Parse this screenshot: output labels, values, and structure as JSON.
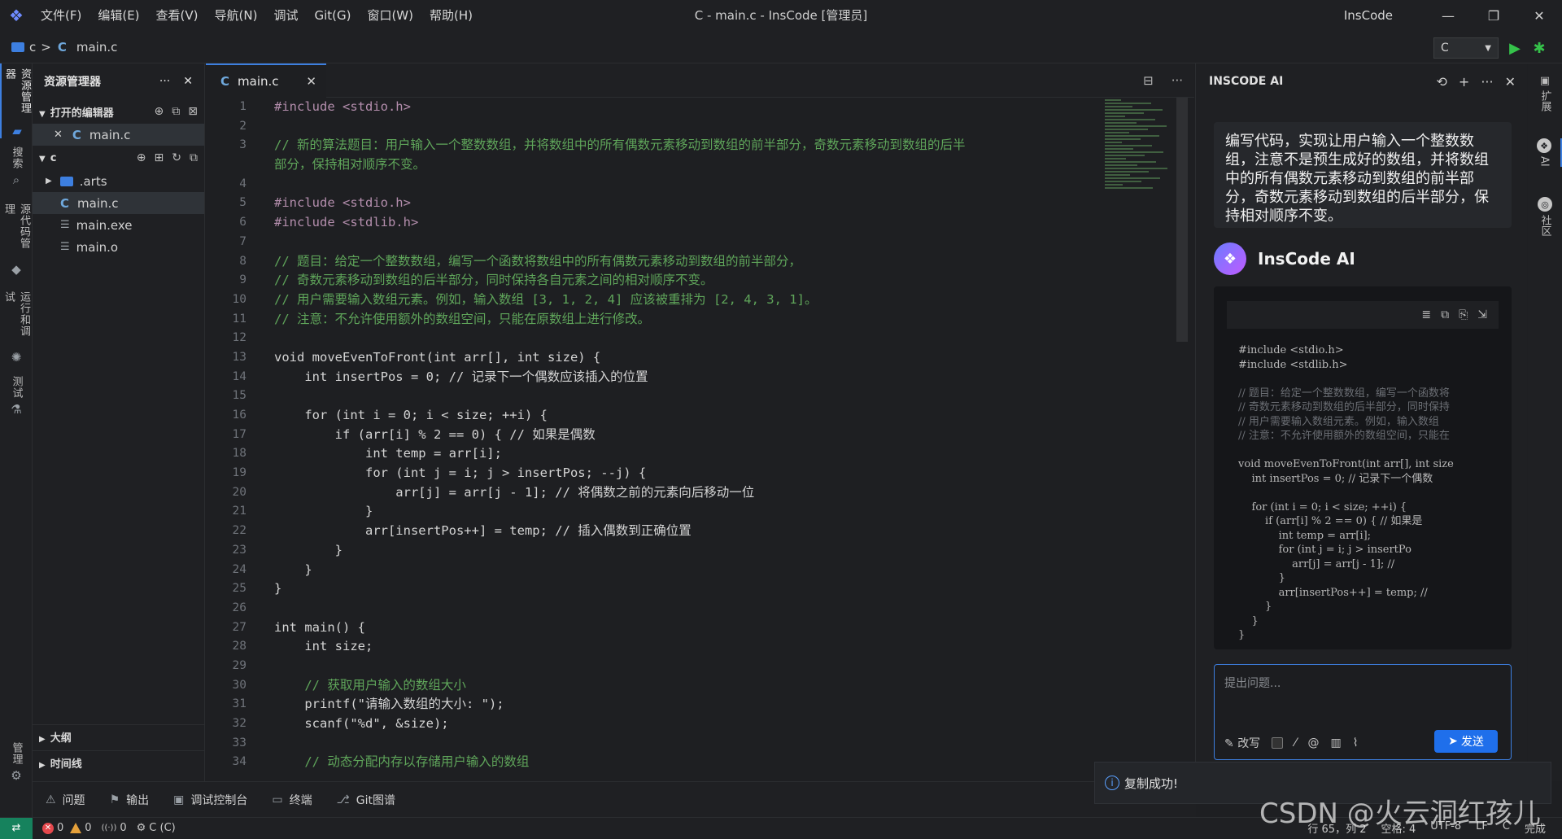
{
  "titlebar": {
    "menus": [
      "文件(F)",
      "编辑(E)",
      "查看(V)",
      "导航(N)",
      "调试",
      "Git(G)",
      "窗口(W)",
      "帮助(H)"
    ],
    "title": "C - main.c - InsCode [管理员]",
    "app_name": "InsCode",
    "minimize": "—",
    "maximize": "❐",
    "close": "✕"
  },
  "breadcrumb": {
    "folder": "c",
    "sep": ">",
    "file": "main.c",
    "file_icon": "C"
  },
  "run_config": {
    "language": "C",
    "caret": "▼",
    "run_glyph": "▶",
    "debug_glyph": "✱"
  },
  "activity_left": {
    "tabs": [
      {
        "label": "资源管理器",
        "icon": "folder-icon"
      },
      {
        "label": "搜索",
        "icon": "search-icon"
      },
      {
        "label": "源代码管理",
        "icon": "source-control-icon"
      },
      {
        "label": "运行和调试",
        "icon": "debug-icon"
      },
      {
        "label": "测试",
        "icon": "flask-icon"
      },
      {
        "label": "管理",
        "icon": "gear-icon"
      }
    ]
  },
  "sidebar": {
    "title": "资源管理器",
    "more": "···",
    "close": "✕",
    "open_editors_label": "打开的编辑器",
    "open_editors": [
      {
        "close": "✕",
        "icon": "C",
        "name": "main.c"
      }
    ],
    "root_label": "c",
    "tree": [
      {
        "name": ".arts",
        "type": "folder"
      },
      {
        "name": "main.c",
        "type": "c"
      },
      {
        "name": "main.exe",
        "type": "file"
      },
      {
        "name": "main.o",
        "type": "file"
      }
    ],
    "outline_label": "大纲",
    "timeline_label": "时间线"
  },
  "editor": {
    "tab_label": "main.c",
    "tab_icon": "C",
    "tab_close": "✕",
    "actions": [
      "⊟",
      "···"
    ],
    "line_numbers": [
      "1",
      "2",
      "3",
      "",
      "4",
      "5",
      "6",
      "7",
      "8",
      "9",
      "10",
      "11",
      "12",
      "13",
      "14",
      "15",
      "16",
      "17",
      "18",
      "19",
      "20",
      "21",
      "22",
      "23",
      "24",
      "25",
      "26",
      "27",
      "28",
      "29",
      "30",
      "31",
      "32",
      "33",
      "34"
    ],
    "lines": [
      "#include <stdio.h>",
      "",
      "// 新的算法题目：用户输入一个整数数组，并将数组中的所有偶数元素移动到数组的前半部分，奇数元素移动到数组的后半",
      "部分，保持相对顺序不变。",
      "",
      "#include <stdio.h>",
      "#include <stdlib.h>",
      "",
      "// 题目：给定一个整数数组，编写一个函数将数组中的所有偶数元素移动到数组的前半部分，",
      "// 奇数元素移动到数组的后半部分，同时保持各自元素之间的相对顺序不变。",
      "// 用户需要输入数组元素。例如，输入数组 [3, 1, 2, 4] 应该被重排为 [2, 4, 3, 1]。",
      "// 注意：不允许使用额外的数组空间，只能在原数组上进行修改。",
      "",
      "void moveEvenToFront(int arr[], int size) {",
      "    int insertPos = 0; // 记录下一个偶数应该插入的位置",
      "",
      "    for (int i = 0; i < size; ++i) {",
      "        if (arr[i] % 2 == 0) { // 如果是偶数",
      "            int temp = arr[i];",
      "            for (int j = i; j > insertPos; --j) {",
      "                arr[j] = arr[j - 1]; // 将偶数之前的元素向后移动一位",
      "            }",
      "            arr[insertPos++] = temp; // 插入偶数到正确位置",
      "        }",
      "    }",
      "}",
      "",
      "int main() {",
      "    int size;",
      "",
      "    // 获取用户输入的数组大小",
      "    printf(\"请输入数组的大小: \");",
      "    scanf(\"%d\", &size);",
      "",
      "    // 动态分配内存以存储用户输入的数组"
    ]
  },
  "ai_panel": {
    "title": "INSCODE AI",
    "tools": [
      "⟲",
      "+",
      "···",
      "✕"
    ],
    "user_message": "编写代码，实现让用户输入一个整数数组，注意不是预生成好的数组，并将数组中的所有偶数元素移动到数组的前半部分，奇数元素移动到数组的后半部分，保持相对顺序不变。",
    "brand": "InsCode AI",
    "code_tools": [
      "≣",
      "⧉",
      "⎘",
      "⇲"
    ],
    "code_lines": [
      "#include <stdio.h>",
      "#include <stdlib.h>",
      "",
      "// 题目：给定一个整数数组，编写一个函数将",
      "// 奇数元素移动到数组的后半部分，同时保持",
      "// 用户需要输入数组元素。例如，输入数组",
      "// 注意：不允许使用额外的数组空间，只能在",
      "",
      "void moveEvenToFront(int arr[], int size",
      "    int insertPos = 0; // 记录下一个偶数",
      "",
      "    for (int i = 0; i < size; ++i) {",
      "        if (arr[i] % 2 == 0) { // 如果是",
      "            int temp = arr[i];",
      "            for (int j = i; j > insertPo",
      "                arr[j] = arr[j - 1]; //",
      "            }",
      "            arr[insertPos++] = temp; //",
      "        }",
      "    }",
      "}"
    ],
    "input_placeholder": "提出问题...",
    "rewrite_label": "改写",
    "send_label": "发送"
  },
  "activity_right": {
    "tabs": [
      {
        "label": "扩展"
      },
      {
        "label": "AI"
      },
      {
        "label": "社区"
      }
    ]
  },
  "bottom_tabs": [
    {
      "label": "问题",
      "icon": "warning-icon",
      "glyph": "⚠"
    },
    {
      "label": "输出",
      "icon": "flag-icon",
      "glyph": "⚑"
    },
    {
      "label": "调试控制台",
      "icon": "console-icon",
      "glyph": "▣"
    },
    {
      "label": "终端",
      "icon": "terminal-icon",
      "glyph": "▭"
    },
    {
      "label": "Git图谱",
      "icon": "git-icon",
      "glyph": "⎇"
    }
  ],
  "toast": {
    "message": "复制成功!",
    "icon": "i"
  },
  "statusbar": {
    "remote": "⇄",
    "errors": "0",
    "warnings": "0",
    "ports": "0",
    "ports_icon": "((·))",
    "lang_mode": "C (C)",
    "position": "行 65，列 2",
    "spaces": "空格: 4",
    "encoding": "UTF-8",
    "eol": "LF",
    "language": "C",
    "feedback": "完成"
  },
  "watermark": "CSDN @火云洞红孩儿"
}
